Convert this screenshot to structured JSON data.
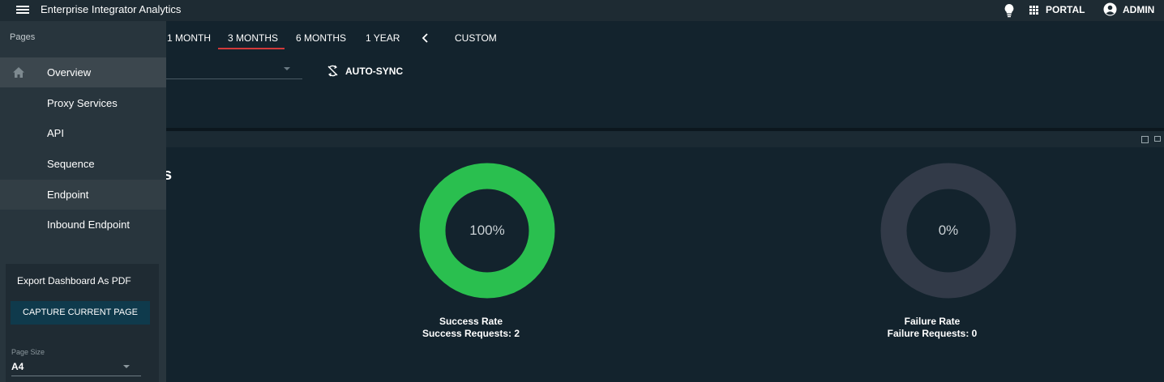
{
  "appbar": {
    "title": "Enterprise Integrator Analytics",
    "portal_label": "PORTAL",
    "admin_label": "ADMIN"
  },
  "date_range": {
    "options": [
      "1 MONTH",
      "3 MONTHS",
      "6 MONTHS",
      "1 YEAR",
      "CUSTOM"
    ],
    "selected": "3 MONTHS",
    "accent_color": "#d23a3a"
  },
  "toolbar": {
    "autosync_label": "AUTO-SYNC"
  },
  "widget": {
    "partial_title": "s",
    "success": {
      "percent_label": "100%",
      "value": 100,
      "color": "#2abf4f",
      "caption_title": "Success Rate",
      "caption_detail": "Success Requests: 2"
    },
    "failure": {
      "percent_label": "0%",
      "value": 0,
      "color": "#323a48",
      "caption_title": "Failure Rate",
      "caption_detail": "Failure Requests: 0"
    }
  },
  "sidebar": {
    "header": "Pages",
    "items": [
      {
        "label": "Overview",
        "icon": "home-icon",
        "state": "active"
      },
      {
        "label": "Proxy Services",
        "state": ""
      },
      {
        "label": "API",
        "state": ""
      },
      {
        "label": "Sequence",
        "state": ""
      },
      {
        "label": "Endpoint",
        "state": "hover"
      },
      {
        "label": "Inbound Endpoint",
        "state": ""
      }
    ]
  },
  "export": {
    "title": "Export Dashboard As PDF",
    "button_label": "CAPTURE CURRENT PAGE",
    "page_size_label": "Page Size",
    "page_size_value": "A4"
  }
}
